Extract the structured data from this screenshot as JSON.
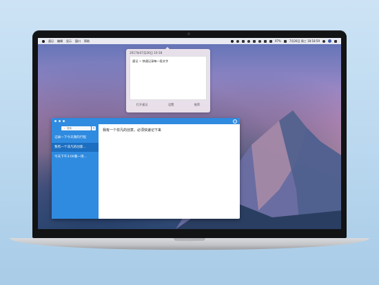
{
  "menubar": {
    "items": [
      "速记",
      "编辑",
      "显示",
      "窗口",
      "帮助"
    ],
    "battery": "97%",
    "clock": "7月26日 周三 18:18:59"
  },
  "popover": {
    "date": "2017年07月26日 10:18",
    "note": "速记 ~ 快速记录每一段文字",
    "actions": [
      "打开速记",
      "设置",
      "推荐"
    ]
  },
  "window": {
    "search_placeholder": "搜索",
    "add_label": "+",
    "items": [
      "记录一下今天我的行程",
      "我有一个非凡的创意...",
      "今天下午3:00看一场..."
    ],
    "editor_text": "我有一个非凡的创意，必须快速记下来"
  },
  "laptop": {
    "brand": "HUAWEI"
  },
  "colors": {
    "accent": "#2f8be0",
    "active_item": "#1c6ec0",
    "menubar_bg": "#f4f4f6"
  }
}
